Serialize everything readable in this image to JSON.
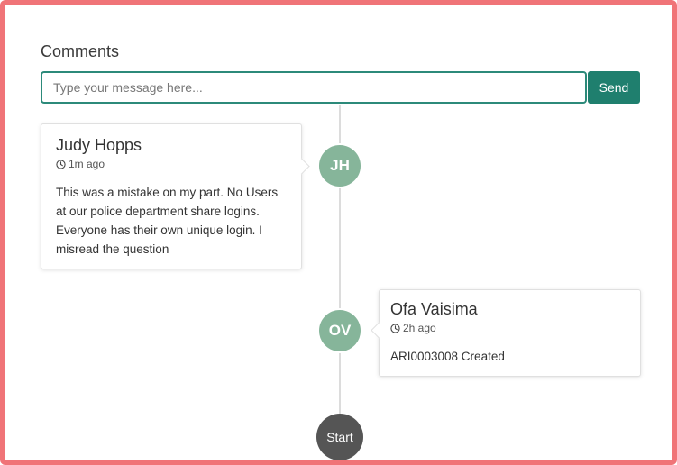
{
  "comments_section": {
    "title": "Comments",
    "input_placeholder": "Type your message here...",
    "input_value": "",
    "send_label": "Send"
  },
  "timeline": {
    "entries": [
      {
        "author": "Judy Hopps",
        "initials": "JH",
        "time": "1m ago",
        "message": "This was a mistake on my part. No Users at our police department share logins. Everyone has their own unique login. I misread the question",
        "side": "left"
      },
      {
        "author": "Ofa Vaisima",
        "initials": "OV",
        "time": "2h ago",
        "message": "ARI0003008 Created",
        "side": "right"
      }
    ],
    "start_label": "Start"
  },
  "colors": {
    "accent": "#1f7f6e",
    "input_border": "#2c8a7a",
    "avatar": "#86b59a",
    "start_node": "#555555",
    "frame_border": "#f07478"
  },
  "icons": {
    "time": "clock-icon"
  }
}
